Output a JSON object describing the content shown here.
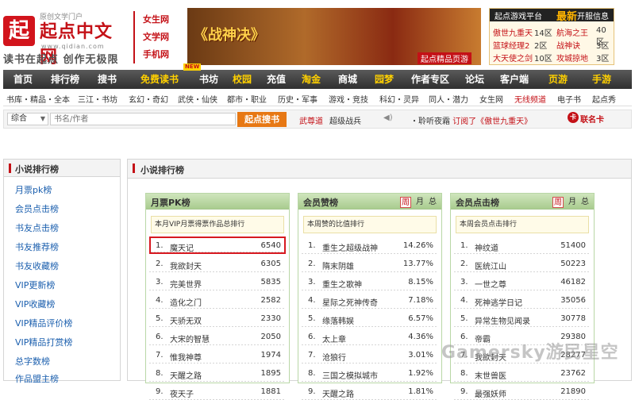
{
  "header": {
    "logo_glyph": "起",
    "logo_sub": "原创文学门户",
    "logo_title": "起点中文网",
    "logo_url": "www.qidian.com",
    "slogan": "读书在起点 创作无极限",
    "site_links": [
      "女生网",
      "文学网",
      "手机网"
    ],
    "banner_title": "《战神决》",
    "banner_sub": "起点精品页游",
    "game_panel": {
      "title": "起点游戏平台",
      "hot": "最新",
      "hot_suffix": "开服信息",
      "rows": [
        {
          "a": "傲世九重天",
          "a_zone": "14区",
          "b": "航海之王",
          "b_zone": "40区"
        },
        {
          "a": "篮球经理2",
          "a_zone": "2区",
          "b": "战神诀",
          "b_zone": "3区"
        },
        {
          "a": "大天使之剑",
          "a_zone": "10区",
          "b": "攻城掠地",
          "b_zone": "3区"
        }
      ]
    }
  },
  "nav": {
    "items": [
      "首页",
      "排行榜",
      "搜书",
      "免费读书",
      "书坊",
      "校园",
      "充值",
      "淘金",
      "商城",
      "园梦",
      "作者专区",
      "论坛",
      "客户端",
      "页游",
      "手游"
    ],
    "badge": "NEW"
  },
  "subnav": {
    "items": [
      "书库・精品・全本",
      "三江・书坊",
      "玄幻・奇幻",
      "武侠・仙侠",
      "都市・职业",
      "历史・军事",
      "游戏・竞技",
      "科幻・灵异",
      "同人・潜力",
      "女生网",
      "无线频道",
      "电子书",
      "起点秀"
    ]
  },
  "search": {
    "scope": "综合",
    "placeholder": "书名/作者",
    "button": "起点搜书",
    "ticker_user": "武尊道",
    "ticker_text": "超级战兵",
    "ticker_user2": "・聆听夜霜",
    "ticker_text2": "订阅了《傲世九重天》",
    "card": "联名卡"
  },
  "sidebar": {
    "title": "小说排行榜",
    "items": [
      "月票pk榜",
      "会员点击榜",
      "书友点击榜",
      "书友推荐榜",
      "书友收藏榜",
      "VIP更新榜",
      "VIP收藏榜",
      "VIP精品评价榜",
      "VIP精品打赏榜",
      "总字数榜",
      "作品盟主榜"
    ]
  },
  "main": {
    "title": "小说排行榜",
    "panels": [
      {
        "title": "月票PK榜",
        "tabs": [],
        "subtitle": "本月VIP月票得票作品总排行",
        "rows": [
          {
            "no": "1.",
            "name": "魔天记",
            "value": "6540"
          },
          {
            "no": "2.",
            "name": "我欲封天",
            "value": "6305"
          },
          {
            "no": "3.",
            "name": "完美世界",
            "value": "5835"
          },
          {
            "no": "4.",
            "name": "造化之门",
            "value": "2582"
          },
          {
            "no": "5.",
            "name": "天骄无双",
            "value": "2330"
          },
          {
            "no": "6.",
            "name": "大宋的智慧",
            "value": "2050"
          },
          {
            "no": "7.",
            "name": "惟我神尊",
            "value": "1974"
          },
          {
            "no": "8.",
            "name": "天醒之路",
            "value": "1895"
          },
          {
            "no": "9.",
            "name": "夜天子",
            "value": "1881"
          }
        ]
      },
      {
        "title": "会员赞榜",
        "tabs": [
          "周",
          "月",
          "总"
        ],
        "subtitle": "本周赞的比值排行",
        "rows": [
          {
            "no": "1.",
            "name": "重生之超级战神",
            "value": "14.26%"
          },
          {
            "no": "2.",
            "name": "隋末阴雄",
            "value": "13.77%"
          },
          {
            "no": "3.",
            "name": "重生之歌神",
            "value": "8.15%"
          },
          {
            "no": "4.",
            "name": "星际之死神传奇",
            "value": "7.18%"
          },
          {
            "no": "5.",
            "name": "缘落韩娱",
            "value": "6.57%"
          },
          {
            "no": "6.",
            "name": "太上章",
            "value": "4.36%"
          },
          {
            "no": "7.",
            "name": "沧狼行",
            "value": "3.01%"
          },
          {
            "no": "8.",
            "name": "三国之模拟城市",
            "value": "1.92%"
          },
          {
            "no": "9.",
            "name": "天醒之路",
            "value": "1.81%"
          }
        ]
      },
      {
        "title": "会员点击榜",
        "tabs": [
          "周",
          "月",
          "总"
        ],
        "subtitle": "本周会员点击排行",
        "rows": [
          {
            "no": "1.",
            "name": "神纹道",
            "value": "51400"
          },
          {
            "no": "2.",
            "name": "医统江山",
            "value": "50223"
          },
          {
            "no": "3.",
            "name": "一世之尊",
            "value": "46182"
          },
          {
            "no": "4.",
            "name": "死神逃学日记",
            "value": "35056"
          },
          {
            "no": "5.",
            "name": "异常生物见闻录",
            "value": "30778"
          },
          {
            "no": "6.",
            "name": "帝霸",
            "value": "29380"
          },
          {
            "no": "7.",
            "name": "我欲封天",
            "value": "28277"
          },
          {
            "no": "8.",
            "name": "末世兽医",
            "value": "23762"
          },
          {
            "no": "9.",
            "name": "最强妖师",
            "value": "21890"
          }
        ]
      }
    ]
  },
  "watermark": "Gamersky游民星空",
  "colors": {
    "brand_red": "#c41117",
    "accent_orange": "#e77814",
    "panel_green": "#a9cc8f"
  }
}
